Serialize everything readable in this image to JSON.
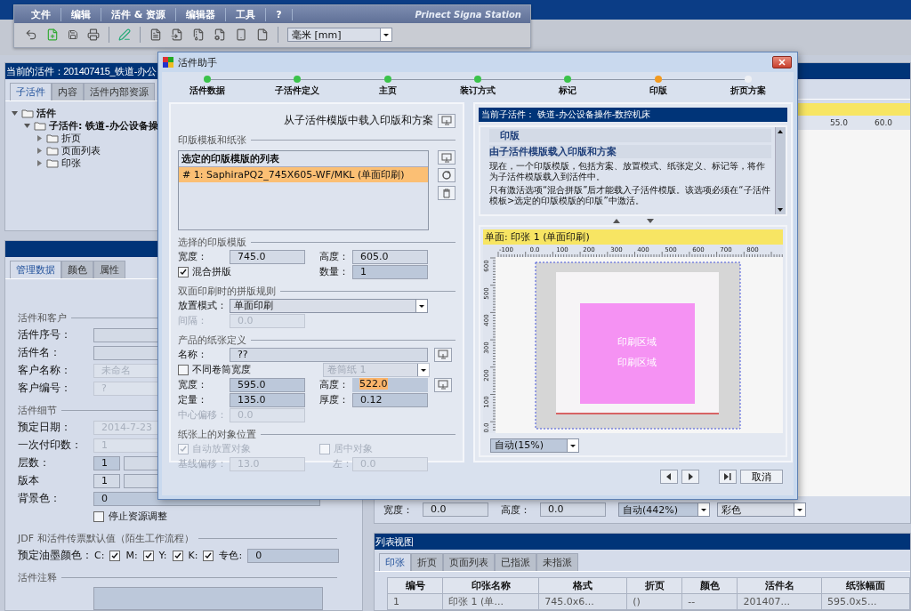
{
  "app": {
    "menu": [
      "文件",
      "编辑",
      "活件 & 资源",
      "编辑器",
      "工具",
      "?"
    ],
    "brand": "Prinect Signa Station",
    "unit": "毫米  [mm]"
  },
  "job_panel": {
    "title": "当前的活件：201407415_铁道-办公",
    "tabs": [
      {
        "label": "子活件",
        "selected": true
      },
      {
        "label": "内容",
        "selected": false
      },
      {
        "label": "活件内部资源",
        "selected": false
      }
    ],
    "tree": [
      {
        "label": "活件",
        "expanded": true,
        "children": [
          {
            "label": "子活件: 铁道-办公设备操",
            "expanded": true,
            "children": [
              {
                "label": "折页",
                "expanded": false
              },
              {
                "label": "页面列表",
                "expanded": false
              },
              {
                "label": "印张",
                "expanded": false
              }
            ]
          }
        ]
      }
    ]
  },
  "admin_panel": {
    "tabs": [
      {
        "label": "管理数据",
        "selected": true
      },
      {
        "label": "颜色",
        "selected": false
      },
      {
        "label": "属性",
        "selected": false
      }
    ],
    "sections": [
      {
        "title": "活件和客户",
        "fields": [
          {
            "label": "活件序号：",
            "kind": "plain",
            "disabled": false
          },
          {
            "label": "活件名：",
            "kind": "plain",
            "disabled": false
          },
          {
            "label": "客户名称：",
            "value": "未命名",
            "kind": "plain",
            "disabled": true
          },
          {
            "label": "客户编号：",
            "value": "?",
            "kind": "plain",
            "disabled": true
          }
        ]
      },
      {
        "title": "活件细节",
        "fields": [
          {
            "label": "预定日期：",
            "value": "2014-7-23",
            "kind": "plain",
            "disabled": true
          },
          {
            "label": "一次付印数：",
            "value": "1",
            "kind": "plain",
            "disabled": true
          },
          {
            "label": "层数：",
            "value": "1",
            "kind": "split",
            "disabled": false
          },
          {
            "label": "版本",
            "value": "1",
            "kind": "split",
            "disabled": false
          },
          {
            "label": "背景色：",
            "value": "0",
            "kind": "wide",
            "disabled": false
          }
        ]
      }
    ],
    "stop_adjust": {
      "label": "停止资源调整",
      "checked": false
    },
    "jdf_title": "JDF 和活件传票默认值（陌生工作流程）",
    "ink_label": "预定油墨颜色：",
    "inks": [
      {
        "label": "C:",
        "checked": true
      },
      {
        "label": "M:",
        "checked": true
      },
      {
        "label": "Y:",
        "checked": true
      },
      {
        "label": "K:",
        "checked": true
      }
    ],
    "spot_label": "专色:",
    "spot_value": "0",
    "notes_title": "活件注释"
  },
  "sheet_view": {
    "ruler_labels": [
      "55.0",
      "60.0"
    ],
    "width_label": "宽度：",
    "width_value": "0.0",
    "height_label": "高度：",
    "height_value": "0.0",
    "zoom": "自动(442%)",
    "color_mode": "彩色"
  },
  "list_view": {
    "title": "列表视图",
    "tabs": [
      {
        "label": "印张",
        "selected": true
      },
      {
        "label": "折页",
        "selected": false
      },
      {
        "label": "页面列表",
        "selected": false
      },
      {
        "label": "已指派",
        "selected": false
      },
      {
        "label": "未指派",
        "selected": false
      }
    ],
    "columns": [
      "编号",
      "印张名称",
      "格式",
      "折页",
      "颜色",
      "活件名",
      "纸张幅面"
    ],
    "rows": [
      [
        "1",
        "印张 1 (单...",
        "745.0x6...",
        "()",
        "--",
        "201407...",
        "595.0x5..."
      ]
    ]
  },
  "wizard": {
    "title": "活件助手",
    "steps": [
      {
        "label": "活件数据",
        "completed": true,
        "selected": false
      },
      {
        "label": "子活件定义",
        "completed": true,
        "selected": false
      },
      {
        "label": "主页",
        "completed": true,
        "selected": false
      },
      {
        "label": "装订方式",
        "completed": true,
        "selected": false
      },
      {
        "label": "标记",
        "completed": true,
        "selected": false
      },
      {
        "label": "印版",
        "completed": false,
        "selected": true
      },
      {
        "label": "折页方案",
        "completed": false,
        "selected": false
      }
    ],
    "load_label": "从子活件模版中载入印版和方案",
    "template_group": "印版模板和纸张",
    "list_header": "选定的印版模版的列表",
    "templates": [
      {
        "label": "# 1: SaphiraPQ2_745X605-WF/MKL (单面印刷)",
        "selected": true
      }
    ],
    "selected_group": "选择的印版模版",
    "plate_width": {
      "label": "宽度：",
      "value": "745.0"
    },
    "plate_height": {
      "label": "高度：",
      "value": "605.0"
    },
    "mixed": {
      "label": "混合拼版",
      "checked": true
    },
    "quantity": {
      "label": "数量：",
      "value": "1"
    },
    "duplex_group": "双面印刷时的拼版规则",
    "placement": {
      "label": "放置模式：",
      "value": "单面印刷"
    },
    "gap": {
      "label": "间隔：",
      "value": "0.0",
      "disabled": true
    },
    "paper_group": "产品的纸张定义",
    "paper_name": {
      "label": "名称：",
      "value": "??"
    },
    "different_widths": {
      "label": "不同卷筒宽度",
      "checked": false
    },
    "roll": {
      "value": "卷筒纸 1",
      "disabled": true
    },
    "paper_fields": [
      {
        "label": "宽度：",
        "value": "595.0",
        "disabled": false,
        "highlighted": false
      },
      {
        "label": "高度：",
        "value": "522.0",
        "disabled": false,
        "highlighted": true
      },
      {
        "label": "定量：",
        "value": "135.0",
        "disabled": false,
        "highlighted": false
      },
      {
        "label": "厚度：",
        "value": "0.12",
        "disabled": false,
        "highlighted": false
      },
      {
        "label": "中心偏移：",
        "value": "0.0",
        "disabled": true,
        "highlighted": false
      }
    ],
    "position_group": "纸张上的对象位置",
    "auto_place": {
      "label": "自动放置对象",
      "checked": true,
      "disabled": true
    },
    "center": {
      "label": "居中对象",
      "checked": false,
      "disabled": true
    },
    "baseline": {
      "label": "基线偏移：",
      "value": "13.0",
      "disabled": true
    },
    "left": {
      "label": "左：",
      "value": "0.0",
      "disabled": true
    },
    "current_label": "当前子活件： 铁道-办公设备操作-数控机床",
    "help": {
      "title": "印版",
      "subtitle": "由子活件模版载入印版和方案",
      "paragraphs": [
        "现在，一个印版模版，包括方案、放置模式、纸张定义、标记等，将作为子活件模版载入到活件中。",
        "只有激活选项“混合拼版”后才能载入子活件模版。该选项必须在“子活件模板>选定的印版模版的印版”中激活。"
      ]
    },
    "preview": {
      "title": "单面:  印张 1 (单面印刷)",
      "x_ticks": [
        "-100",
        "0.0",
        "100",
        "200",
        "300",
        "400",
        "500",
        "600",
        "700",
        "800"
      ],
      "y_ticks": [
        "600",
        "500",
        "400",
        "300",
        "200",
        "100",
        "0.0"
      ],
      "area_labels": [
        "印刷区域",
        "印刷区域"
      ],
      "zoom": "自动(15%)"
    },
    "cancel": "取消"
  }
}
